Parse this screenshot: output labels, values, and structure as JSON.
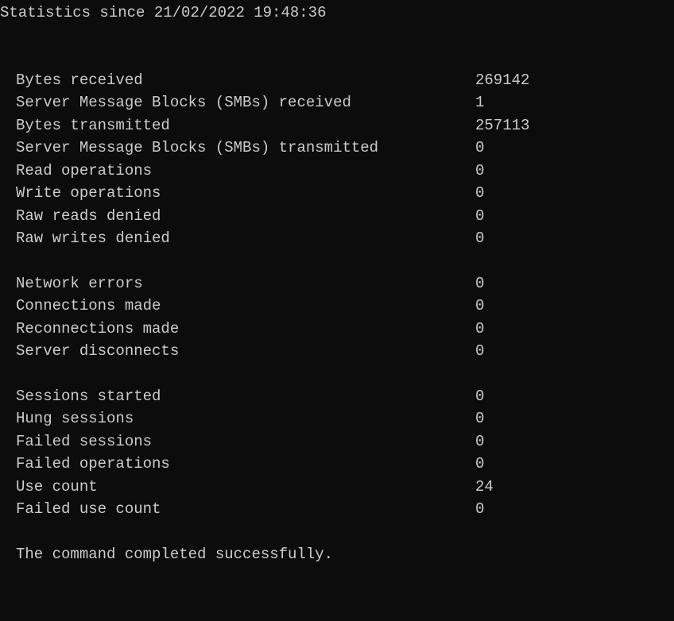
{
  "header": "Statistics since 21/02/2022 19:48:36",
  "groups": [
    [
      {
        "label": "Bytes received",
        "value": "269142"
      },
      {
        "label": "Server Message Blocks (SMBs) received",
        "value": "1"
      },
      {
        "label": "Bytes transmitted",
        "value": "257113"
      },
      {
        "label": "Server Message Blocks (SMBs) transmitted",
        "value": "0"
      },
      {
        "label": "Read operations",
        "value": "0"
      },
      {
        "label": "Write operations",
        "value": "0"
      },
      {
        "label": "Raw reads denied",
        "value": "0"
      },
      {
        "label": "Raw writes denied",
        "value": "0"
      }
    ],
    [
      {
        "label": "Network errors",
        "value": "0"
      },
      {
        "label": "Connections made",
        "value": "0"
      },
      {
        "label": "Reconnections made",
        "value": "0"
      },
      {
        "label": "Server disconnects",
        "value": "0"
      }
    ],
    [
      {
        "label": "Sessions started",
        "value": "0"
      },
      {
        "label": "Hung sessions",
        "value": "0"
      },
      {
        "label": "Failed sessions",
        "value": "0"
      },
      {
        "label": "Failed operations",
        "value": "0"
      },
      {
        "label": "Use count",
        "value": "24"
      },
      {
        "label": "Failed use count",
        "value": "0"
      }
    ]
  ],
  "footer": "The command completed successfully."
}
